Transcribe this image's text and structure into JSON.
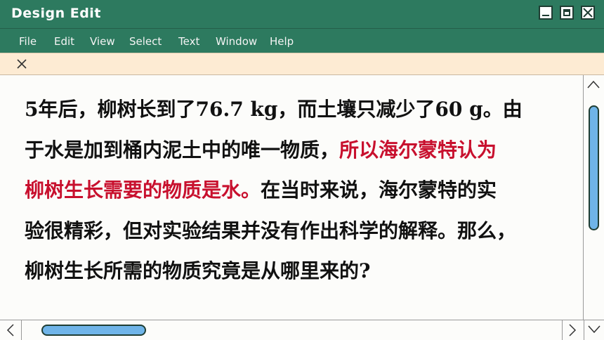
{
  "window": {
    "title": "Design Edit"
  },
  "menu": {
    "items": [
      "File",
      "Edit",
      "View",
      "Select",
      "Text",
      "Window",
      "Help"
    ]
  },
  "content": {
    "lines": [
      [
        {
          "text": "5年后，柳树长到了76.7 kg，而土壤只减少了60 g。由",
          "red": false
        }
      ],
      [
        {
          "text": "于水是加到桶内泥土中的唯一物质，",
          "red": false
        },
        {
          "text": "所以海尔蒙特认为",
          "red": true
        }
      ],
      [
        {
          "text": "柳树生长需要的物质是水。",
          "red": true
        },
        {
          "text": "在当时来说，海尔蒙特的实",
          "red": false
        }
      ],
      [
        {
          "text": "验很精彩，但对实验结果并没有作出科学的解释。那么，",
          "red": false
        }
      ],
      [
        {
          "text": "柳树生长所需的物质究竟是从哪里来的?",
          "red": false
        }
      ]
    ]
  },
  "colors": {
    "titlebar": "#2d7a5f",
    "tabbar": "#fdebd3",
    "highlight_text": "#c8102e",
    "scroll_thumb": "#6fb4e8"
  },
  "icons": [
    "minimize-icon",
    "maximize-icon",
    "close-icon",
    "tab-close-icon",
    "scroll-up-icon",
    "scroll-down-icon",
    "scroll-left-icon",
    "scroll-right-icon"
  ]
}
